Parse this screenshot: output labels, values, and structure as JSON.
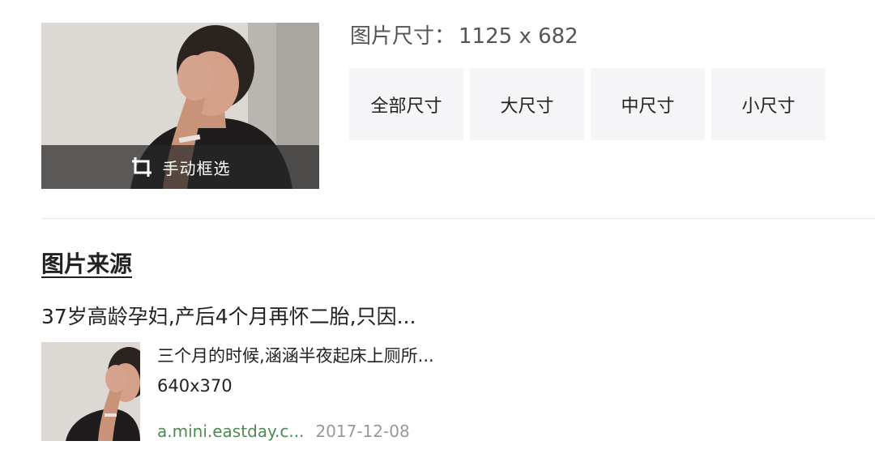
{
  "preview": {
    "crop_label": "手动框选",
    "crop_icon": "crop-icon"
  },
  "size_info": {
    "label": "图片尺寸：",
    "value": "1125 x 682"
  },
  "size_filters": [
    {
      "label": "全部尺寸"
    },
    {
      "label": "大尺寸"
    },
    {
      "label": "中尺寸"
    },
    {
      "label": "小尺寸"
    }
  ],
  "source": {
    "heading": "图片来源",
    "title": "37岁高龄孕妇,产后4个月再怀二胎,只因...",
    "description": "三个月的时候,涵涵半夜起床上厕所...",
    "dimensions": "640x370",
    "url": "a.mini.eastday.c...",
    "date": "2017-12-08"
  },
  "colors": {
    "url_green": "#4e8a54",
    "date_gray": "#999999",
    "button_bg": "#f5f5f7"
  }
}
